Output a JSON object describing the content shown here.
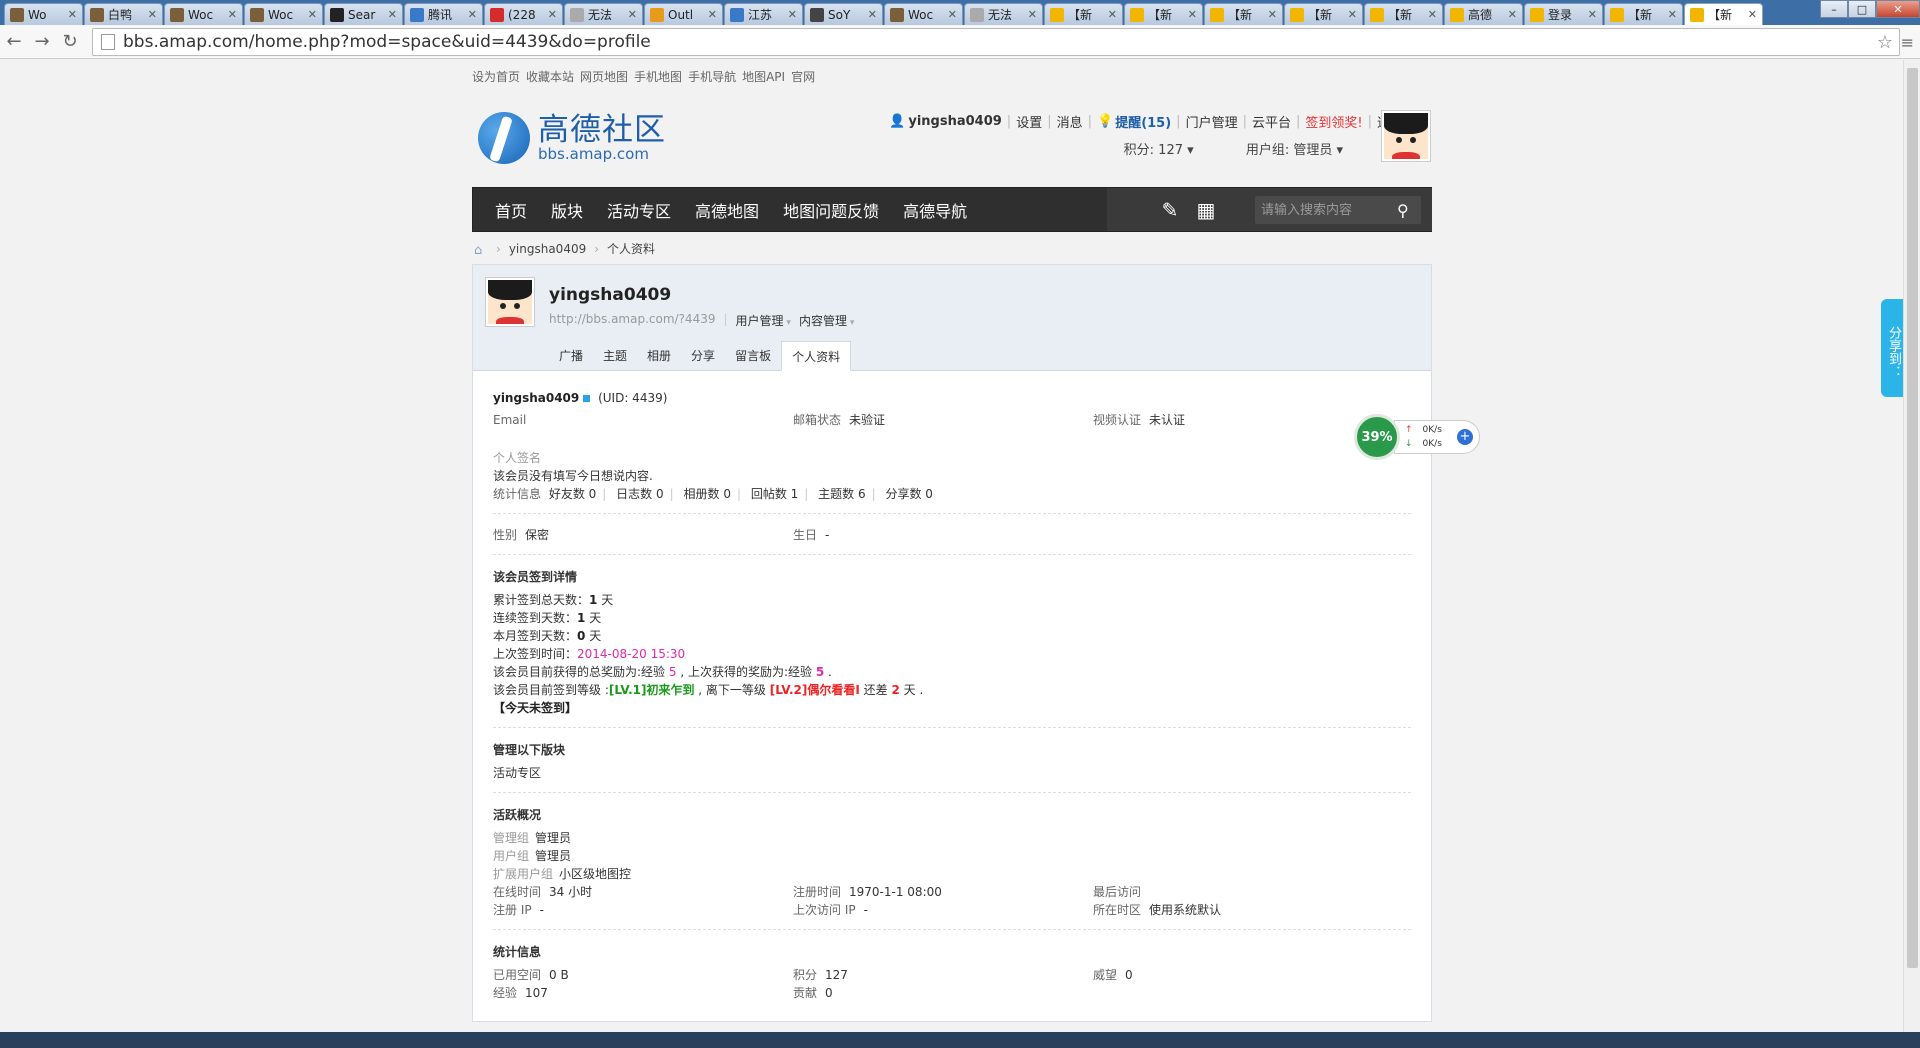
{
  "browser": {
    "tabs": [
      {
        "label": "Wo",
        "color": "#7a5f3a"
      },
      {
        "label": "白鸭",
        "color": "#7a5f3a"
      },
      {
        "label": "Woc",
        "color": "#7a5f3a"
      },
      {
        "label": "Woc",
        "color": "#7a5f3a"
      },
      {
        "label": "Sear",
        "color": "#222222"
      },
      {
        "label": "腾讯",
        "color": "#3a78c8"
      },
      {
        "label": "(228",
        "color": "#d62b2b"
      },
      {
        "label": "无法",
        "color": "#aaaaaa"
      },
      {
        "label": "Outl",
        "color": "#e89b1a"
      },
      {
        "label": "江苏",
        "color": "#3a78c8"
      },
      {
        "label": "SoY",
        "color": "#444444"
      },
      {
        "label": "Woc",
        "color": "#7a5f3a"
      },
      {
        "label": "无法",
        "color": "#aaaaaa"
      },
      {
        "label": "【新",
        "color": "#f2b500"
      },
      {
        "label": "【新",
        "color": "#f2b500"
      },
      {
        "label": "【新",
        "color": "#f2b500"
      },
      {
        "label": "【新",
        "color": "#f2b500"
      },
      {
        "label": "【新",
        "color": "#f2b500"
      },
      {
        "label": "高德",
        "color": "#f2b500"
      },
      {
        "label": "登录",
        "color": "#f2b500"
      },
      {
        "label": "【新",
        "color": "#f2b500"
      },
      {
        "label": "【新",
        "color": "#f2b500"
      }
    ],
    "url": "bbs.amap.com/home.php?mod=space&uid=4439&do=profile"
  },
  "topstrip": [
    "设为首页",
    "收藏本站",
    "网页地图",
    "手机地图",
    "手机导航",
    "地图API",
    "官网"
  ],
  "logo": {
    "cn": "高德社区",
    "en": "bbs.amap.com"
  },
  "usernav": {
    "username": "yingsha0409",
    "settings": "设置",
    "messages": "消息",
    "remind": "提醒(15)",
    "portal": "门户管理",
    "cloud": "云平台",
    "sign": "签到领奖!",
    "logout": "退出",
    "points": "积分: 127",
    "group": "用户组: 管理员"
  },
  "mainnav": {
    "items": [
      "首页",
      "版块",
      "活动专区",
      "高德地图",
      "地图问题反馈",
      "高德导航"
    ],
    "search_placeholder": "请输入搜索内容"
  },
  "breadcrumb": {
    "user": "yingsha0409",
    "page": "个人资料"
  },
  "profile_head": {
    "name": "yingsha0409",
    "url": "http://bbs.amap.com/?4439",
    "user_manage": "用户管理",
    "content_manage": "内容管理",
    "tabs": [
      "广播",
      "主题",
      "相册",
      "分享",
      "留言板",
      "个人资料"
    ]
  },
  "profile": {
    "username": "yingsha0409",
    "uid": "(UID: 4439)",
    "email_label": "Email",
    "email_status_label": "邮箱状态",
    "email_status": "未验证",
    "video_label": "视频认证",
    "video_status": "未认证",
    "sig_label": "个人签名",
    "sig_text": "该会员没有填写今日想说内容.",
    "stats_label": "统计信息",
    "friends": "好友数 0",
    "blogs": "日志数 0",
    "albums": "相册数 0",
    "replies": "回帖数 1",
    "threads": "主题数 6",
    "shares": "分享数 0",
    "gender_label": "性别",
    "gender": "保密",
    "birthday_label": "生日",
    "birthday": "-"
  },
  "signin": {
    "title": "该会员签到详情",
    "total_pre": "累计签到总天数：",
    "total_val": "1",
    "total_post": " 天",
    "streak_pre": "连续签到天数：",
    "streak_val": "1",
    "streak_post": " 天",
    "month_pre": "本月签到天数：",
    "month_val": "0",
    "month_post": " 天",
    "last_pre": "上次签到时间：",
    "last_val": "2014-08-20 15:30",
    "reward_pre": "该会员目前获得的总奖励为:经验 ",
    "reward_val": "5",
    "reward_mid": " , 上次获得的奖励为:经验 ",
    "reward_last": "5",
    "reward_post": " .",
    "level_pre": "该会员目前签到等级 :",
    "level_val": "[LV.1]初来乍到",
    "level_mid": " , 离下一等级 ",
    "level_next": "[LV.2]偶尔看看I",
    "level_mid2": " 还差 ",
    "level_days": "2",
    "level_post": " 天 .",
    "today": "【今天未签到】"
  },
  "manage": {
    "title": "管理以下版块",
    "forum": "活动专区"
  },
  "activity": {
    "title": "活跃概况",
    "admin_group_label": "管理组",
    "admin_group": "管理员",
    "user_group_label": "用户组",
    "user_group": "管理员",
    "ext_group_label": "扩展用户组",
    "ext_group": "小区级地图控",
    "online_label": "在线时间",
    "online": "34 小时",
    "reg_time_label": "注册时间",
    "reg_time": "1970-1-1 08:00",
    "last_visit_label": "最后访问",
    "last_visit": "",
    "reg_ip_label": "注册 IP",
    "reg_ip": "-",
    "last_ip_label": "上次访问 IP",
    "last_ip": "-",
    "tz_label": "所在时区",
    "tz": "使用系统默认"
  },
  "stats": {
    "title": "统计信息",
    "space_label": "已用空间",
    "space": "0 B",
    "points_label": "积分",
    "points": "127",
    "prestige_label": "威望",
    "prestige": "0",
    "exp_label": "经验",
    "exp": "107",
    "contrib_label": "贡献",
    "contrib": "0"
  },
  "share_tab": "分享到：",
  "speed": {
    "percent": "39%",
    "up": "0K/s",
    "down": "0K/s"
  }
}
